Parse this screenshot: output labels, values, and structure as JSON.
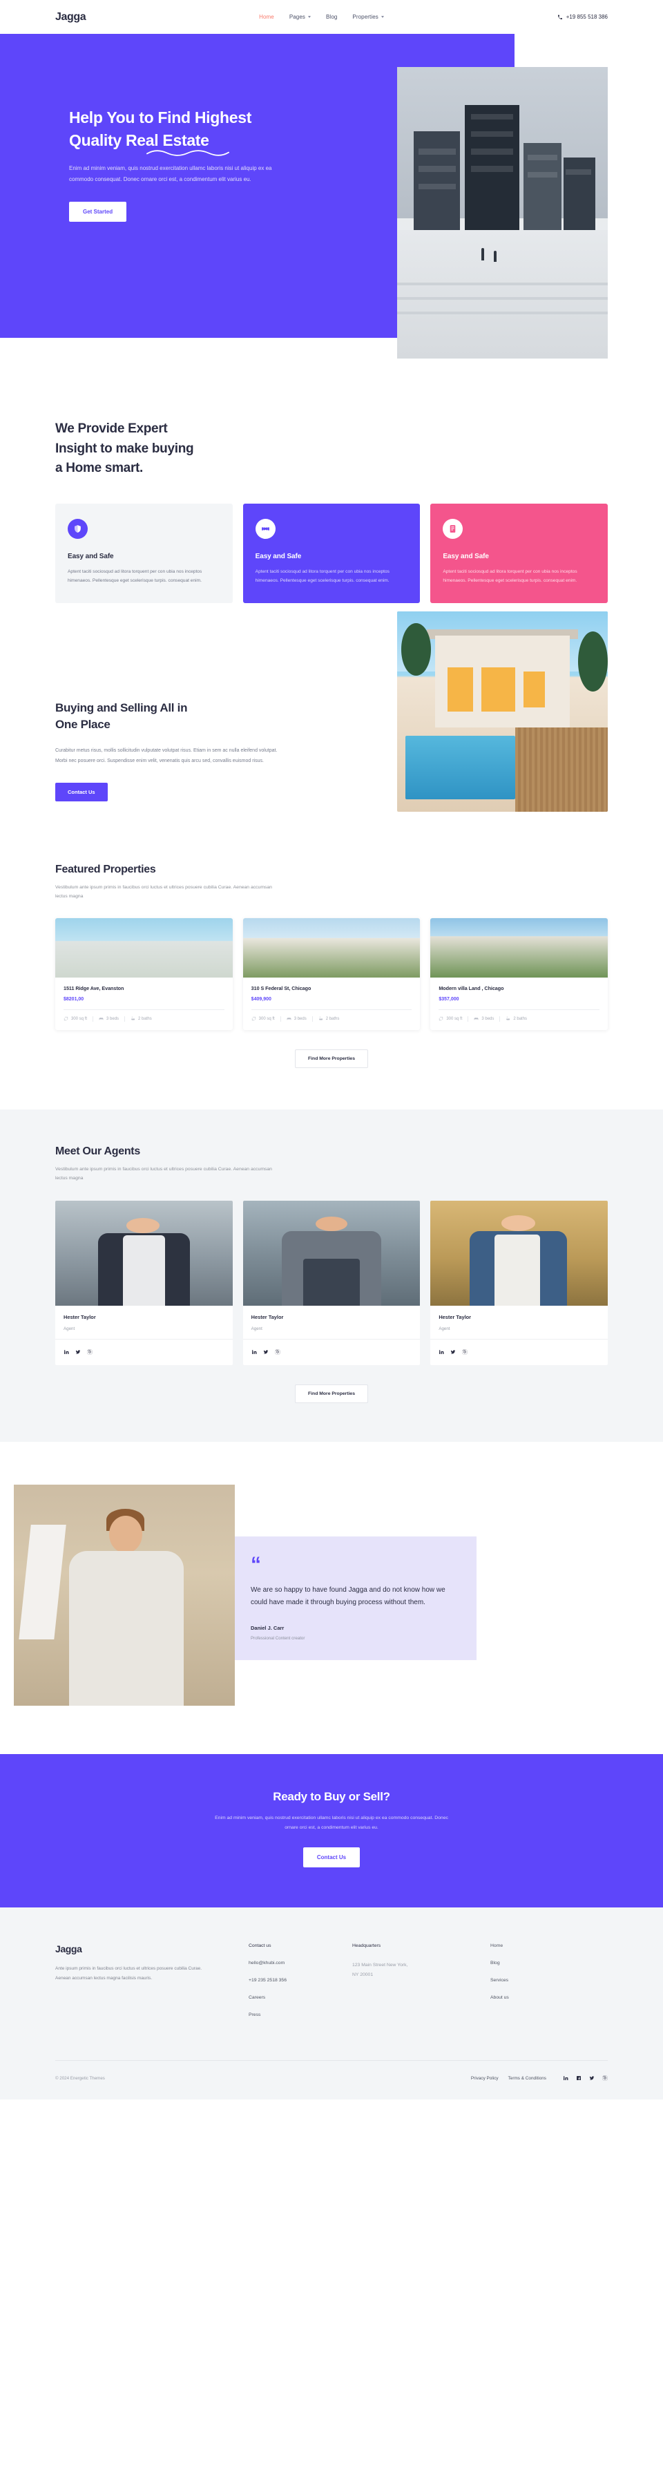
{
  "header": {
    "logo": "Jagga",
    "nav": [
      {
        "label": "Home",
        "active": true,
        "caret": false
      },
      {
        "label": "Pages",
        "active": false,
        "caret": true
      },
      {
        "label": "Blog",
        "active": false,
        "caret": false
      },
      {
        "label": "Properties",
        "active": false,
        "caret": true
      }
    ],
    "phone": "+19 855 518 386",
    "phone_icon": "phone-icon"
  },
  "hero": {
    "title_line1": "Help You to Find Highest",
    "title_line2": "Quality Real Estate",
    "paragraph": "Enim ad minim veniam, quis nostrud exercitation ullamc laboris nisi ut aliquip ex ea commodo consequat. Donec ornare orci est, a condimentum elit varius eu.",
    "cta_label": "Get Started"
  },
  "expert": {
    "title_line1": "We Provide Expert",
    "title_line2": "Insight to make buying",
    "title_line3": "a Home smart.",
    "cards": [
      {
        "icon": "shield-icon",
        "title": "Easy and Safe",
        "text": "Aptent taciti sociosqud ad litora torquent per con ubia nos inceptos himenaeos. Pellentesque eget scelerisque turpis. consequat enim.",
        "theme": "grey"
      },
      {
        "icon": "handshake-icon",
        "title": "Easy and Safe",
        "text": "Aptent taciti sociosqud ad litora torquent per con ubia nos inceptos himenaeos. Pellentesque eget scelerisque turpis. consequat enim.",
        "theme": "purple"
      },
      {
        "icon": "document-icon",
        "title": "Easy and Safe",
        "text": "Aptent taciti sociosqud ad litora torquent per con ubia nos inceptos himenaeos. Pellentesque eget scelerisque turpis. consequat enim.",
        "theme": "pink"
      }
    ]
  },
  "buying": {
    "title_line1": "Buying and Selling All in",
    "title_line2": "One Place",
    "paragraph": "Curabitur metus risus, mollis sollicitudin vulputate volutpat risus. Etiam in sem ac nulla eleifend volutpat. Morbi nec posuere orci. Suspendisse enim velit, venenatis quis arcu sed, convallis euismod risus.",
    "cta_label": "Contact Us"
  },
  "featured": {
    "title": "Featured Properties",
    "subtitle": "Vestibulum ante ipsum primis in faucibus orci luctus et ultrices posuere cubilia Curae. Aenean accumsan lectus magna",
    "properties": [
      {
        "title": "1511 Ridge Ave, Evanston",
        "price": "$8201,00",
        "area": "300 sq ft",
        "beds": "3 beds",
        "baths": "2 baths"
      },
      {
        "title": "310 S Federal St, Chicago",
        "price": "$409,900",
        "area": "300 sq ft",
        "beds": "3 beds",
        "baths": "2 baths"
      },
      {
        "title": "Modern villa Land , Chicago",
        "price": "$357,000",
        "area": "300 sq ft",
        "beds": "3 beds",
        "baths": "2 baths"
      }
    ],
    "cta_label": "Find More Properties"
  },
  "agents": {
    "title": "Meet Our Agents",
    "subtitle": "Vestibulum ante ipsum primis in faucibus orci luctus et ultrices posuere cubilia Curae. Aenean accumsan lectus magna",
    "list": [
      {
        "name": "Hester Taylor",
        "role": "Agent"
      },
      {
        "name": "Hester Taylor",
        "role": "Agent"
      },
      {
        "name": "Hester Taylor",
        "role": "Agent"
      }
    ],
    "social": [
      "linkedin-icon",
      "twitter-icon",
      "instagram-icon"
    ],
    "cta_label": "Find More Properties"
  },
  "testimonial": {
    "quote_mark": "“",
    "quote": "We are so happy to have found Jagga and do not know how we could have made it through buying process without them.",
    "author": "Daniel J. Carr",
    "author_role": "Professional Content creator"
  },
  "cta": {
    "title": "Ready to Buy or Sell?",
    "paragraph": "Enim ad minim veniam, quis nostrud exercitation ullamc laboris nisi ut aliquip ex ea commodo consequat. Donec ornare orci est, a condimentum elit varius eu.",
    "button": "Contact Us"
  },
  "footer": {
    "logo": "Jagga",
    "about": "Ante ipsum primis in faucibus orci luctus et ultrices posuere cubilia Curae. Aenean accumsan lectus magna facilisis mauris.",
    "contact": {
      "heading": "Contact us",
      "email": "hello@khubi.com",
      "phone": "+19 235 2518 356",
      "careers": "Careers",
      "press": "Press"
    },
    "hq": {
      "heading": "Headquarters",
      "address_line1": "123 Main Street New York,",
      "address_line2": "NY 20001"
    },
    "links": [
      "Home",
      "Blog",
      "Services",
      "About us"
    ],
    "copyright": "© 2024 Energetic Themes",
    "legal": [
      "Privacy Policy",
      "Terms & Conditions"
    ],
    "social": [
      "linkedin-icon",
      "facebook-icon",
      "twitter-icon",
      "instagram-icon"
    ]
  },
  "colors": {
    "purple": "#5E46FA",
    "pink": "#F4558C",
    "coral": "#F8786A",
    "dark": "#2B2D42",
    "light_grey": "#F3F5F7",
    "lavender": "#E6E3FA"
  }
}
